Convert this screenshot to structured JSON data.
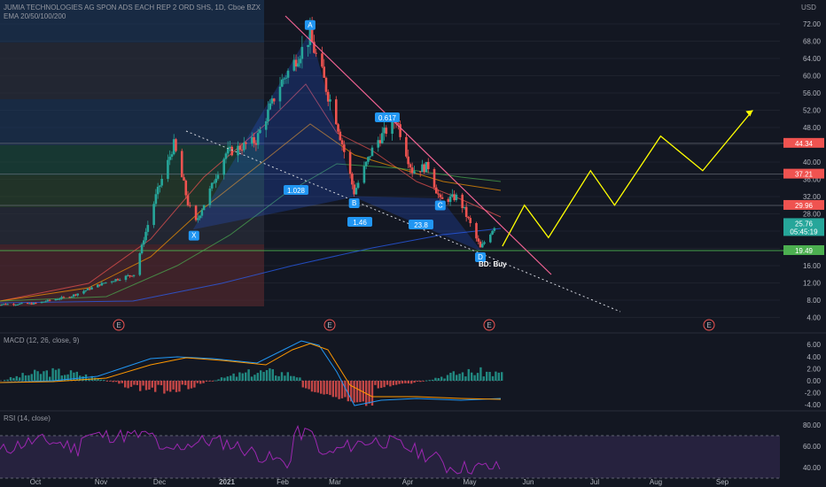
{
  "header": {
    "title": "JUMIA TECHNOLOGIES AG SPON ADS EACH REP 2 ORD SHS, 1D, Cboe BZX",
    "indicator": "EMA 20/50/100/200",
    "currency": "USD",
    "macd_label": "MACD (12, 26, close, 9)",
    "rsi_label": "RSI (14, close)"
  },
  "colors": {
    "background": "#131722",
    "up": "#26a69a",
    "down": "#ef5350",
    "projection": "#ffff00",
    "trendline": "#f06292",
    "pattern_fill": "#2962ff",
    "support_line": "#4caf50",
    "rsi_line": "#9c27b0"
  },
  "chart_data": [
    {
      "type": "candlestick",
      "ylabel": "USD",
      "y_ticks": [
        72,
        68,
        64,
        60,
        56,
        52,
        48,
        44,
        40,
        36,
        32,
        28,
        24,
        20,
        16,
        12,
        8,
        4
      ],
      "x_ticks": [
        "Oct",
        "Nov",
        "Dec",
        "2021",
        "Feb",
        "Mar",
        "Apr",
        "May",
        "Jun",
        "Jul",
        "Aug",
        "Sep"
      ],
      "price_labels": [
        {
          "value": 44.34,
          "text": "44.34",
          "color": "#ef5350"
        },
        {
          "value": 37.21,
          "text": "37.21",
          "color": "#ef5350"
        },
        {
          "value": 29.96,
          "text": "29.96",
          "color": "#ef5350"
        },
        {
          "value": 25.76,
          "text": "25.76",
          "sub": "05:45:19",
          "color": "#26a69a"
        },
        {
          "value": 19.49,
          "text": "19.49",
          "color": "#4caf50"
        }
      ],
      "harmonic_points": [
        {
          "label": "X",
          "date": "2020-12-20",
          "price": 24.5
        },
        {
          "label": "A",
          "date": "2021-02-16",
          "price": 70.0
        },
        {
          "label": "B",
          "date": "2021-03-10",
          "price": 32.0
        },
        {
          "label": "C",
          "date": "2021-04-22",
          "price": 31.5
        },
        {
          "label": "D",
          "date": "2021-05-12",
          "price": 19.5
        }
      ],
      "ratios": [
        "0.617",
        "1.028",
        "1.46",
        "23.8"
      ],
      "annotation": "BD: Buy",
      "earnings_markers": [
        "E",
        "E",
        "E",
        "E"
      ],
      "projection_path": [
        {
          "date": "2021-05-23",
          "price": 20.5
        },
        {
          "date": "2021-06-03",
          "price": 30.0
        },
        {
          "date": "2021-06-15",
          "price": 22.5
        },
        {
          "date": "2021-07-06",
          "price": 38.0
        },
        {
          "date": "2021-07-18",
          "price": 30.0
        },
        {
          "date": "2021-08-10",
          "price": 46.0
        },
        {
          "date": "2021-08-31",
          "price": 38.0
        },
        {
          "date": "2021-09-25",
          "price": 52.0
        }
      ]
    },
    {
      "type": "macd",
      "title": "MACD (12, 26, close, 9)",
      "y_ticks": [
        6.0,
        4.0,
        2.0,
        0.0,
        -2.0,
        -4.0
      ]
    },
    {
      "type": "rsi",
      "title": "RSI (14, close)",
      "y_ticks": [
        80.0,
        60.0,
        40.0
      ]
    }
  ]
}
